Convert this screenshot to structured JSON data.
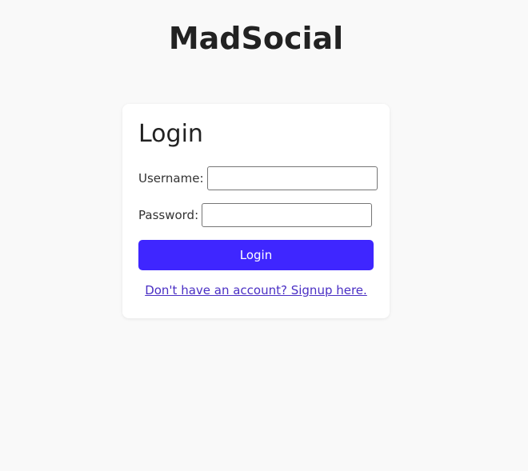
{
  "app": {
    "title": "MadSocial"
  },
  "login_form": {
    "heading": "Login",
    "username": {
      "label": "Username:",
      "value": "",
      "placeholder": ""
    },
    "password": {
      "label": "Password:",
      "value": "",
      "placeholder": ""
    },
    "submit_label": "Login",
    "signup_link_text": "Don't have an account? Signup here."
  },
  "colors": {
    "background": "#f9f9f9",
    "card": "#ffffff",
    "primary_button": "#3f26ff",
    "link": "#4a2fc4"
  }
}
